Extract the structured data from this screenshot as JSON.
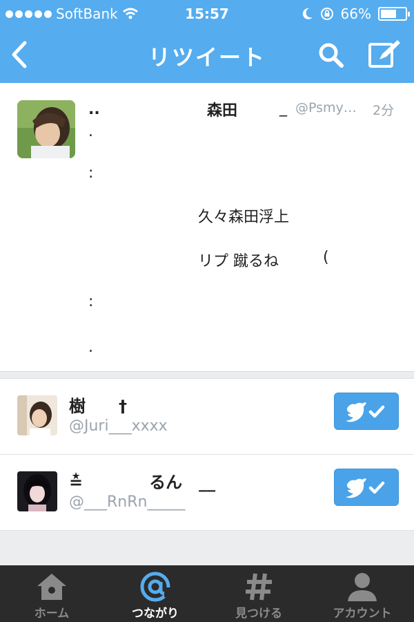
{
  "status_bar": {
    "carrier": "SoftBank",
    "time": "15:57",
    "battery": "66%",
    "battery_level": 0.66
  },
  "nav": {
    "title": "リツイート"
  },
  "tweet": {
    "name_part1": "..",
    "name_part2": "森田",
    "name_part3": "_",
    "handle": "@Psmy…",
    "time": "2分",
    "lines": [
      ".",
      ":",
      "久々森田浮上",
      "リプ 蹴るね",
      "(",
      ":",
      "."
    ]
  },
  "retweeters": [
    {
      "name": "樹　　†",
      "handle": "@Juri___xxxx"
    },
    {
      "name": "≛　　　　るん　__",
      "handle": "@___RnRn_____"
    }
  ],
  "tabs": [
    {
      "label": "ホーム",
      "icon": "home-icon"
    },
    {
      "label": "つながり",
      "icon": "at-icon"
    },
    {
      "label": "見つける",
      "icon": "hashtag-icon"
    },
    {
      "label": "アカウント",
      "icon": "person-icon"
    }
  ],
  "colors": {
    "brand": "#55acee",
    "tabbar": "#2b2b2b",
    "muted_text": "#9aa4ad",
    "follow_button": "#4aa3e8"
  }
}
